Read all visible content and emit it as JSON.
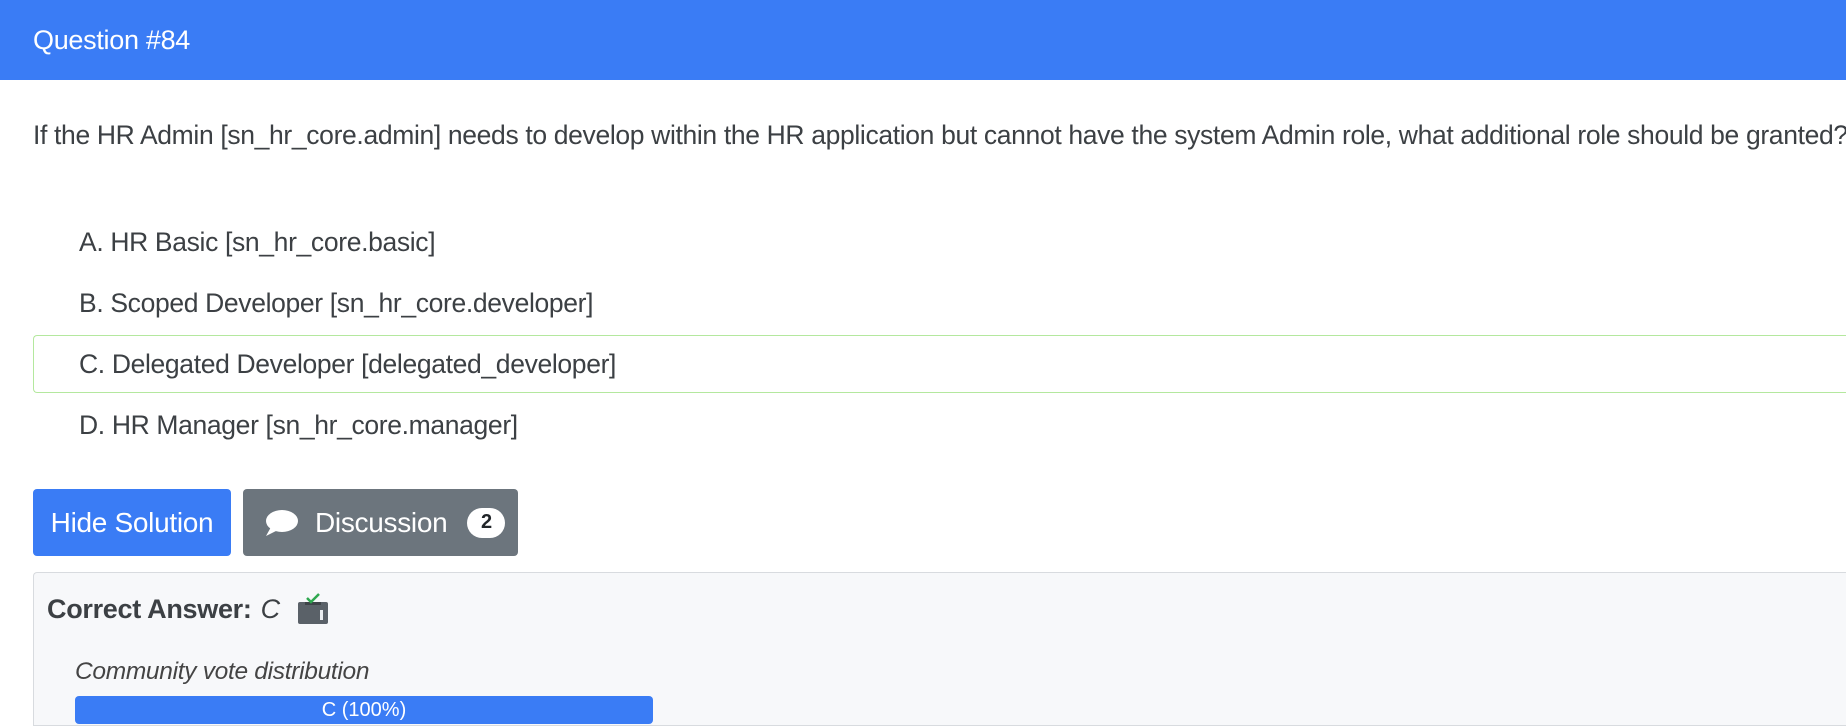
{
  "header": {
    "title": "Question #84"
  },
  "question": {
    "text": "If the HR Admin [sn_hr_core.admin] needs to develop within the HR application but cannot have the system Admin role, what additional role should be granted?"
  },
  "choices": [
    {
      "letter": "A.",
      "text": "HR Basic [sn_hr_core.basic]",
      "correct": false
    },
    {
      "letter": "B.",
      "text": "Scoped Developer [sn_hr_core.developer]",
      "correct": false
    },
    {
      "letter": "C.",
      "text": "Delegated Developer [delegated_developer]",
      "correct": true
    },
    {
      "letter": "D.",
      "text": "HR Manager [sn_hr_core.manager]",
      "correct": false
    }
  ],
  "actions": {
    "solution_label": "Hide Solution",
    "discussion_label": "Discussion",
    "discussion_count": "2",
    "discussion_icon": "comment-icon"
  },
  "answer": {
    "label": "Correct Answer:",
    "value": "C",
    "vote_icon": "ballot-box-icon",
    "vote_caption": "Community vote distribution",
    "vote_bar_label": "C (100%)",
    "vote_fraction": 1.0
  },
  "colors": {
    "primary": "#3a7cf5",
    "secondary": "#6c757d",
    "correct_border": "#b4e89e",
    "panel_bg": "#f7f8fa"
  }
}
